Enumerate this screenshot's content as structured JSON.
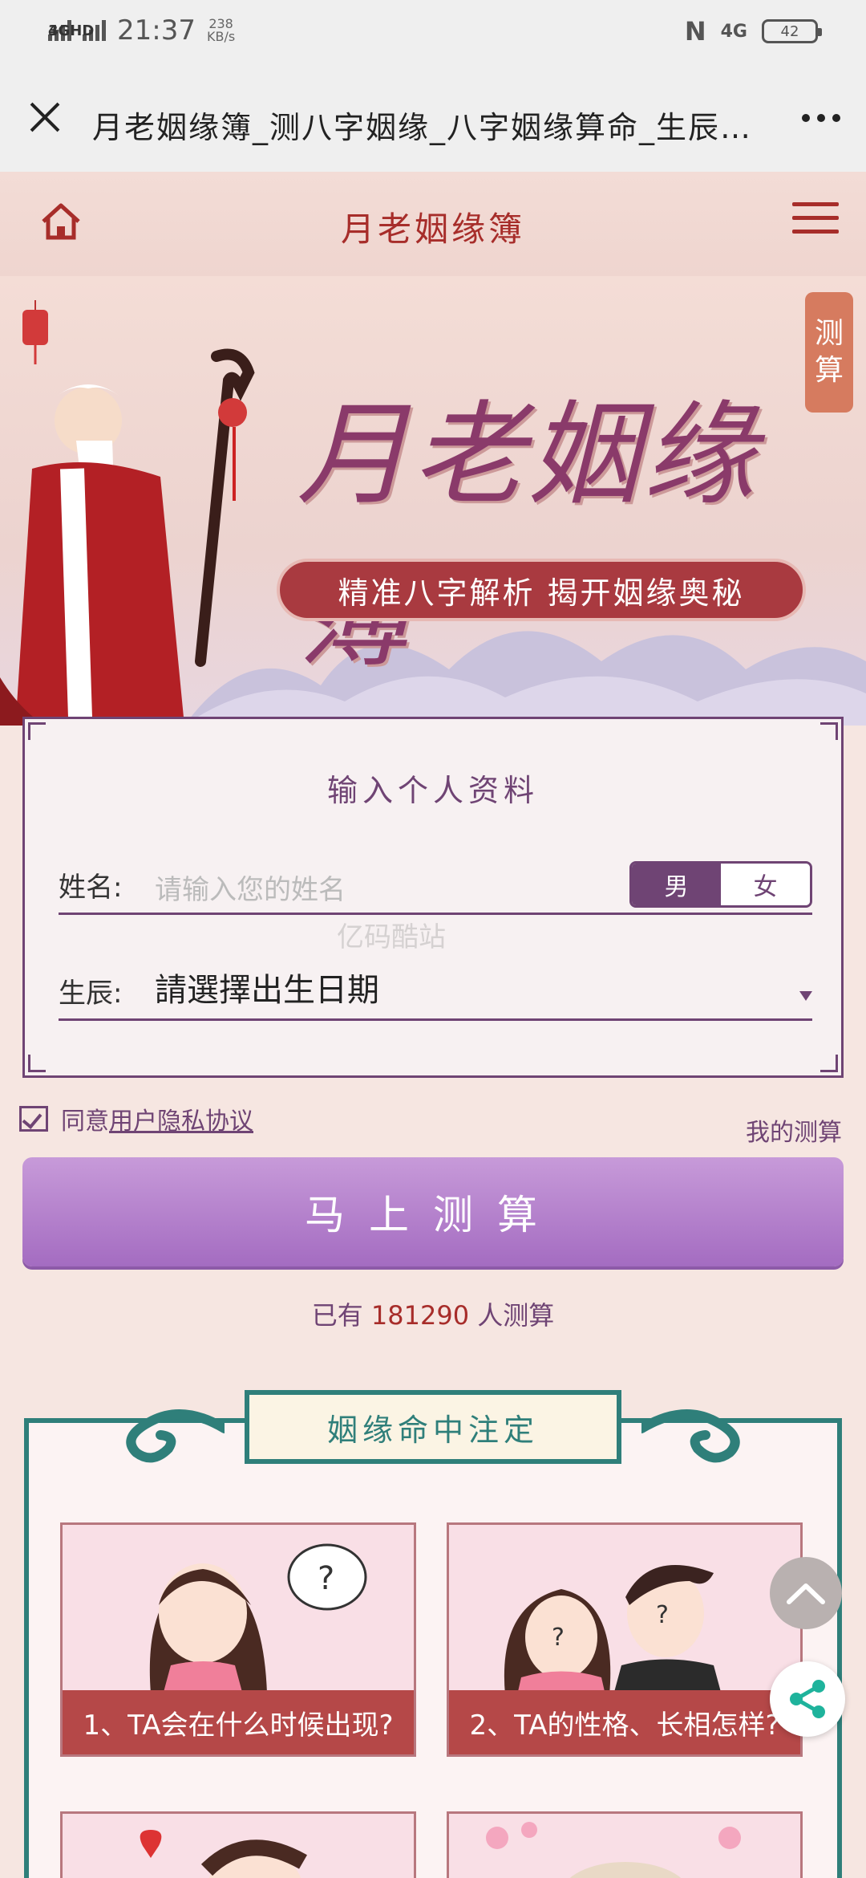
{
  "status": {
    "net1": "4GHD",
    "net2": "3G",
    "time": "21:37",
    "speed_value": "238",
    "speed_unit": "KB/s",
    "net_right": "4G",
    "battery": "42"
  },
  "titlebar": {
    "title": "月老姻缘簿_测八字姻缘_八字姻缘算命_生辰…"
  },
  "header": {
    "title": "月老姻缘簿"
  },
  "banner": {
    "big_title": "月老姻缘簿",
    "slogan": "精准八字解析  揭开姻缘奥秘",
    "side_tag_1": "测",
    "side_tag_2": "算"
  },
  "form": {
    "heading": "输入个人资料",
    "name_label": "姓名:",
    "name_placeholder": "请输入您的姓名",
    "gender_male": "男",
    "gender_female": "女",
    "date_label": "生辰:",
    "date_value": "請選擇出生日期"
  },
  "agreement": {
    "prefix": "同意",
    "link": "用户隐私协议",
    "my_calc": "我的测算"
  },
  "submit_label": "马上测算",
  "counter": {
    "prefix": "已有",
    "count": "181290",
    "suffix": "人测算"
  },
  "watermark": "亿码酷站",
  "destiny": {
    "title": "姻缘命中注定",
    "cards": [
      {
        "caption": "1、TA会在什么时候出现?"
      },
      {
        "caption": "2、TA的性格、长相怎样?"
      }
    ]
  },
  "colors": {
    "accent_purple": "#6f4474",
    "accent_red": "#a72d2a",
    "teal": "#2f7f7a",
    "card_red": "#b54848"
  }
}
